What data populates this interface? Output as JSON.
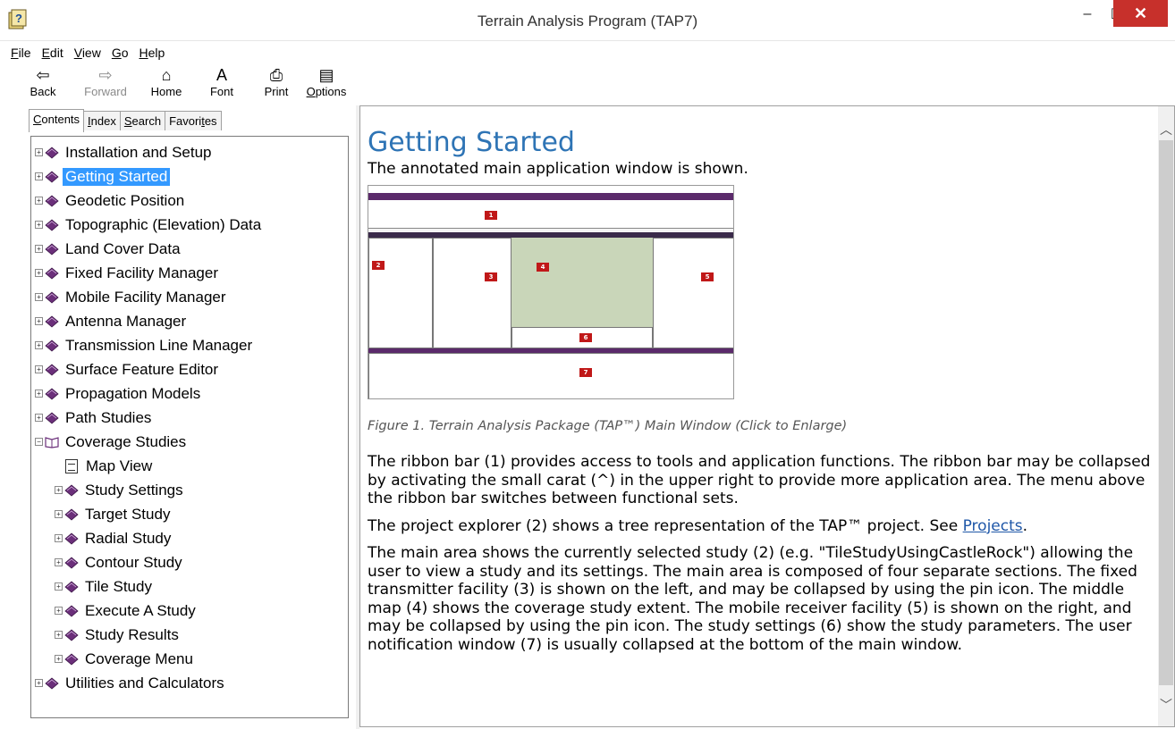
{
  "window": {
    "title": "Terrain Analysis Program (TAP7)",
    "minimize_glyph": "–",
    "maximize_glyph": "☐",
    "close_glyph": "✕"
  },
  "menu": [
    {
      "label": "File"
    },
    {
      "label": "Edit"
    },
    {
      "label": "View"
    },
    {
      "label": "Go"
    },
    {
      "label": "Help"
    }
  ],
  "toolbar": {
    "back": "Back",
    "forward": "Forward",
    "home": "Home",
    "font": "Font",
    "print": "Print",
    "options": "Options"
  },
  "tabs": {
    "contents": "Contents",
    "index": "Index",
    "search": "Search",
    "favorites": "Favorites"
  },
  "tree": {
    "items": [
      {
        "label": "Installation and Setup"
      },
      {
        "label": "Getting Started"
      },
      {
        "label": "Geodetic Position"
      },
      {
        "label": "Topographic (Elevation) Data"
      },
      {
        "label": "Land Cover Data"
      },
      {
        "label": "Fixed Facility Manager"
      },
      {
        "label": "Mobile Facility Manager"
      },
      {
        "label": "Antenna Manager"
      },
      {
        "label": "Transmission Line Manager"
      },
      {
        "label": "Surface Feature Editor"
      },
      {
        "label": "Propagation Models"
      },
      {
        "label": "Path Studies"
      },
      {
        "label": "Coverage Studies"
      },
      {
        "label": "Map View"
      },
      {
        "label": "Study Settings"
      },
      {
        "label": "Target Study"
      },
      {
        "label": "Radial Study"
      },
      {
        "label": "Contour Study"
      },
      {
        "label": "Tile Study"
      },
      {
        "label": "Execute A Study"
      },
      {
        "label": "Study Results"
      },
      {
        "label": "Coverage Menu"
      },
      {
        "label": "Utilities and Calculators"
      }
    ]
  },
  "content": {
    "heading": "Getting Started",
    "intro": "The annotated main application window is shown.",
    "caption": "Figure 1.  Terrain Analysis Package (TAP™) Main Window (Click to Enlarge)",
    "p1": "The ribbon bar (1) provides access to tools and application functions. The ribbon bar may be collapsed by activating the small carat (^) in the upper right to provide more application area. The menu above the ribbon bar switches between functional sets.",
    "p2_before": "The project explorer (2) shows a tree representation of the TAP™ project. See ",
    "p2_link": "Projects",
    "p2_after": ".",
    "p3": "The main area shows the currently selected study (2) (e.g. \"TileStudyUsingCastleRock\") allowing the user to view a study and its settings. The main area is composed of four separate sections. The fixed transmitter facility (3) is shown on the left, and may be collapsed by using the pin icon. The middle map (4) shows the coverage study extent. The mobile receiver facility (5) is shown on the right, and may be collapsed by using the pin icon. The study settings (6) show the study parameters. The user notification window (7) is usually collapsed at the bottom of the main window.",
    "figure_badges": [
      "1",
      "2",
      "3",
      "4",
      "5",
      "6",
      "7"
    ]
  },
  "colors": {
    "selection": "#3399ff",
    "heading": "#2e74b5",
    "close_button": "#c7302b",
    "link": "#1f57a8",
    "book": "#6b2f7a"
  }
}
